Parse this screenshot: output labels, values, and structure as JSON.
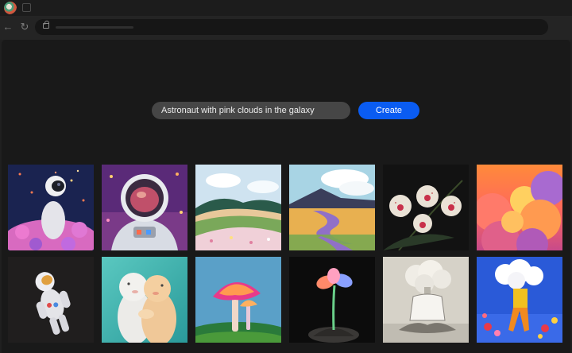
{
  "browser": {
    "favicon": "app-logo",
    "nav_icons": [
      "back-arrow-icon",
      "reload-icon"
    ],
    "address_icon": "lock-icon"
  },
  "generator": {
    "prompt_value": "Astronaut with pink clouds in the galaxy",
    "create_label": "Create"
  },
  "gallery": {
    "images": [
      "astronaut-in-pink-flowers",
      "astronaut-helmet-closeup",
      "green-hills-landscape",
      "mountain-valley-river",
      "white-orchids",
      "sunset-clouds",
      "floating-astronaut",
      "hugging-otters",
      "glowing-mushroom",
      "glowing-sprout",
      "cloud-head-person-meditating",
      "cloud-head-person-walking"
    ]
  },
  "colors": {
    "accent": "#0a5cf2",
    "page_bg": "#191919",
    "input_bg": "#464646"
  }
}
